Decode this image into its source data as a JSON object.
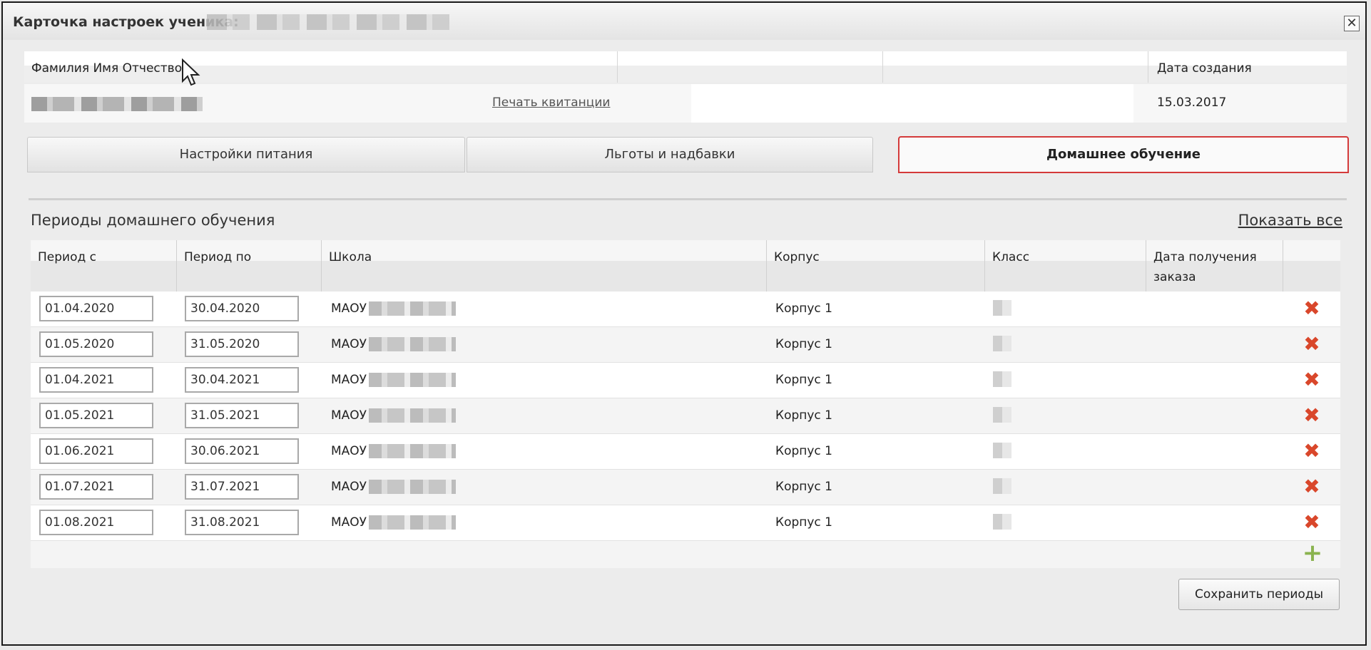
{
  "window": {
    "title": "Карточка настроек ученика:",
    "close_symbol": "✕"
  },
  "info": {
    "headers": [
      "Фамилия Имя Отчество",
      "",
      "",
      "Дата создания"
    ],
    "print_link": "Печать квитанции",
    "date_created": "15.03.2017"
  },
  "tabs": [
    {
      "label": "Настройки питания",
      "active": false
    },
    {
      "label": "Льготы и надбавки",
      "active": false
    },
    {
      "label": "Домашнее обучение",
      "active": true
    }
  ],
  "section": {
    "title": "Периоды домашнего обучения",
    "show_all": "Показать все"
  },
  "table": {
    "headers": [
      "Период с",
      "Период по",
      "Школа",
      "Корпус",
      "Класс",
      "Дата получения заказа"
    ],
    "rows": [
      {
        "from": "01.04.2020",
        "to": "30.04.2020",
        "school": "МАОУ",
        "building": "Корпус 1"
      },
      {
        "from": "01.05.2020",
        "to": "31.05.2020",
        "school": "МАОУ",
        "building": "Корпус 1"
      },
      {
        "from": "01.04.2021",
        "to": "30.04.2021",
        "school": "МАОУ",
        "building": "Корпус 1"
      },
      {
        "from": "01.05.2021",
        "to": "31.05.2021",
        "school": "МАОУ",
        "building": "Корпус 1"
      },
      {
        "from": "01.06.2021",
        "to": "30.06.2021",
        "school": "МАОУ",
        "building": "Корпус 1"
      },
      {
        "from": "01.07.2021",
        "to": "31.07.2021",
        "school": "МАОУ",
        "building": "Корпус 1"
      },
      {
        "from": "01.08.2021",
        "to": "31.08.2021",
        "school": "МАОУ",
        "building": "Корпус 1"
      }
    ]
  },
  "buttons": {
    "save_periods": "Сохранить периоды"
  },
  "icons": {
    "delete": "delete-icon",
    "add": "add-icon",
    "close": "close-icon"
  },
  "colors": {
    "active_tab_outline": "#d43a3a",
    "delete_icon": "#d9472b",
    "add_icon": "#8ab34f"
  }
}
